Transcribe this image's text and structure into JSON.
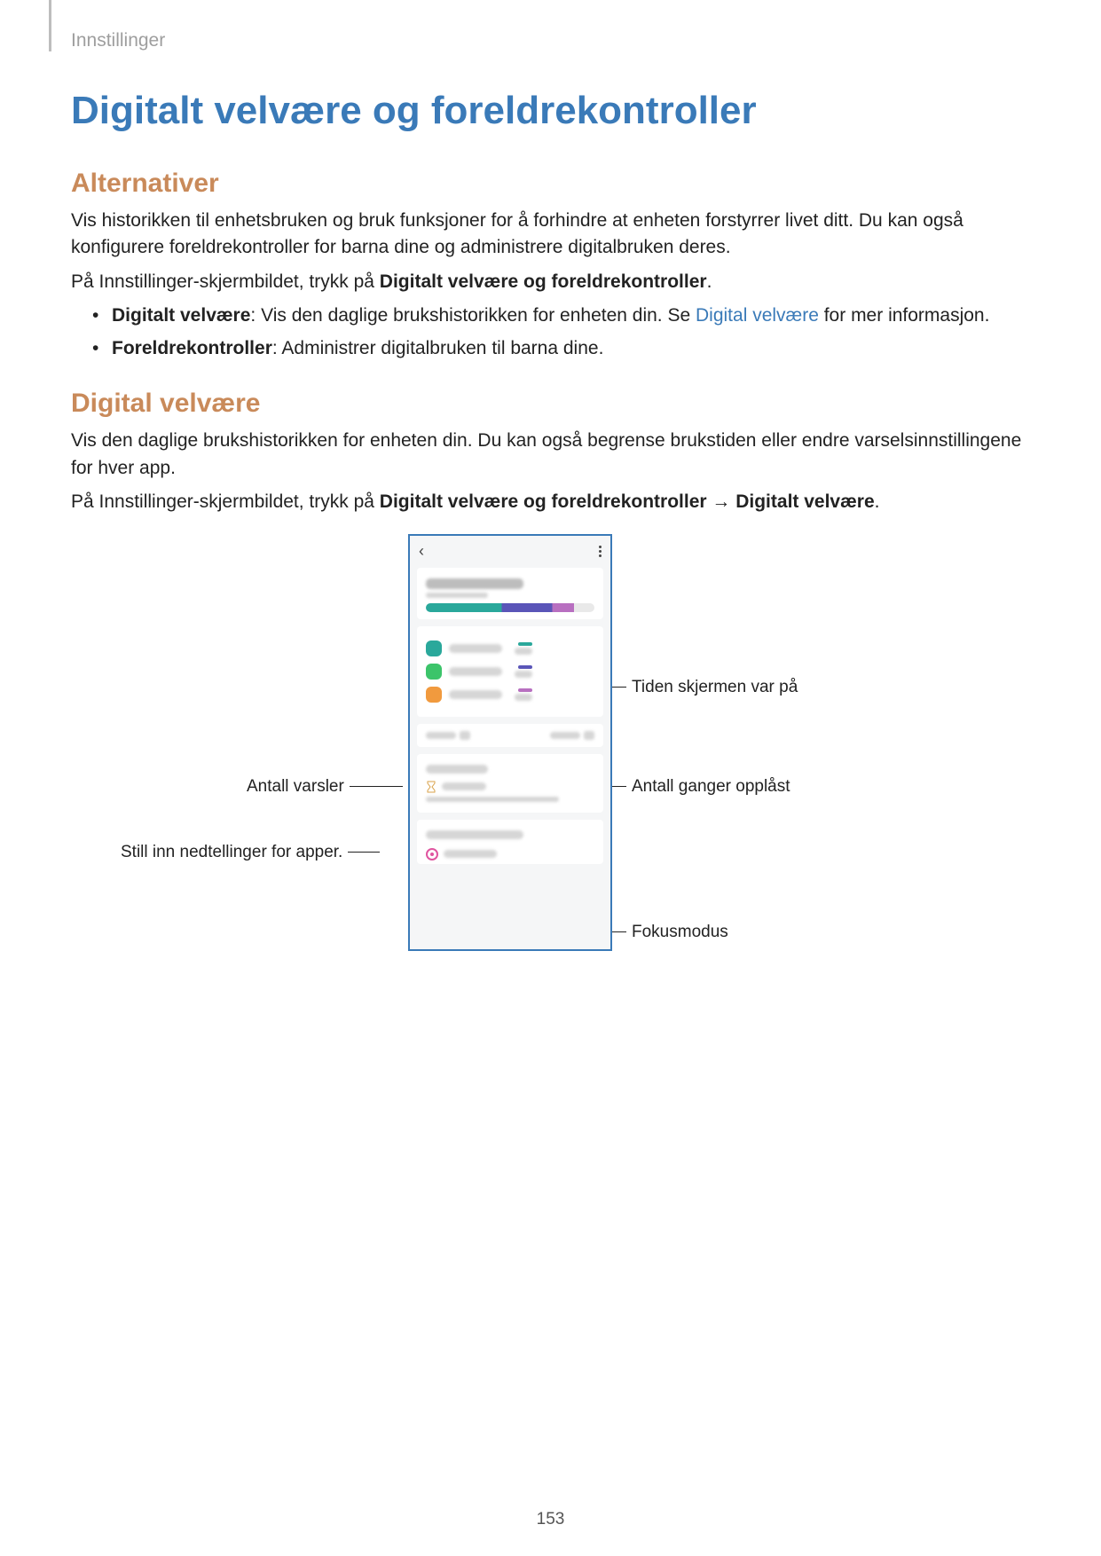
{
  "breadcrumb": "Innstillinger",
  "title": "Digitalt velvære og foreldrekontroller",
  "section_alt": {
    "heading": "Alternativer",
    "p1": "Vis historikken til enhetsbruken og bruk funksjoner for å forhindre at enheten forstyrrer livet ditt. Du kan også konfigurere foreldrekontroller for barna dine og administrere digitalbruken deres.",
    "p2_pre": "På Innstillinger-skjermbildet, trykk på ",
    "p2_bold": "Digitalt velvære og foreldrekontroller",
    "p2_post": ".",
    "bullet1_bold": "Digitalt velvære",
    "bullet1_mid": ": Vis den daglige brukshistorikken for enheten din. Se ",
    "bullet1_link": "Digital velvære",
    "bullet1_post": " for mer informasjon.",
    "bullet2_bold": "Foreldrekontroller",
    "bullet2_post": ": Administrer digitalbruken til barna dine."
  },
  "section_dv": {
    "heading": "Digital velvære",
    "p1": "Vis den daglige brukshistorikken for enheten din. Du kan også begrense brukstiden eller endre varselsinnstillingene for hver app.",
    "p2_pre": "På Innstillinger-skjermbildet, trykk på ",
    "p2_bold1": "Digitalt velvære og foreldrekontroller",
    "p2_arrow": " → ",
    "p2_bold2": "Digitalt velvære",
    "p2_post": "."
  },
  "callouts": {
    "screen_time": "Tiden skjermen var på",
    "notifications": "Antall varsler",
    "unlocks": "Antall ganger opplåst",
    "timers": "Still inn nedtellinger for apper.",
    "focus": "Fokusmodus"
  },
  "page_number": "153"
}
